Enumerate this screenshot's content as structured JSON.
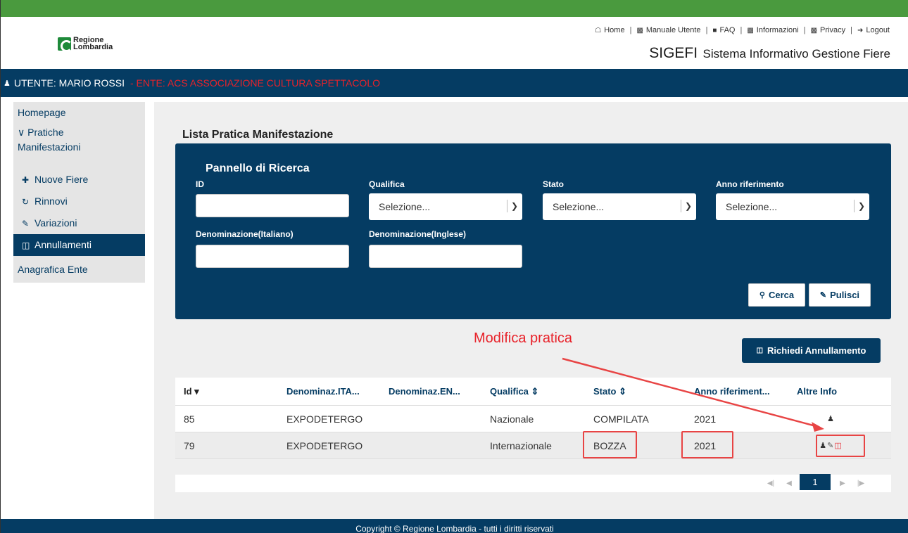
{
  "header": {
    "logo_line1": "Regione",
    "logo_line2": "Lombardia",
    "links": [
      {
        "label": "Home",
        "icon": "home-icon"
      },
      {
        "label": "Manuale Utente",
        "icon": "document-icon"
      },
      {
        "label": "FAQ",
        "icon": "faq-icon"
      },
      {
        "label": "Informazioni",
        "icon": "document-icon"
      },
      {
        "label": "Privacy",
        "icon": "document-icon"
      },
      {
        "label": "Logout",
        "icon": "logout-icon"
      }
    ],
    "app_name": "SIGEFI",
    "app_subtitle": "Sistema Informativo Gestione Fiere"
  },
  "userbar": {
    "user": "UTENTE: MARIO ROSSI",
    "ente": "- ENTE: ACS ASSOCIAZIONE CULTURA SPETTACOLO"
  },
  "sidebar": {
    "homepage": "Homepage",
    "pratiche_line1": "Pratiche",
    "pratiche_line2": "Manifestazioni",
    "sub_items": [
      {
        "label": "Nuove Fiere",
        "icon": "plus-icon"
      },
      {
        "label": "Rinnovi",
        "icon": "refresh-icon"
      },
      {
        "label": "Variazioni",
        "icon": "pencil-icon"
      },
      {
        "label": "Annullamenti",
        "icon": "trash-icon",
        "active": true
      }
    ],
    "anagrafica": "Anagrafica Ente"
  },
  "main": {
    "title": "Lista Pratica Manifestazione",
    "search_panel": {
      "title": "Pannello di Ricerca",
      "id_label": "ID",
      "id_value": "",
      "qualifica_label": "Qualifica",
      "qualifica_value": "Selezione...",
      "stato_label": "Stato",
      "stato_value": "Selezione...",
      "anno_label": "Anno riferimento",
      "anno_value": "Selezione...",
      "den_it_label": "Denominazione(Italiano)",
      "den_it_value": "",
      "den_en_label": "Denominazione(Inglese)",
      "den_en_value": "",
      "cerca_label": "Cerca",
      "pulisci_label": "Pulisci"
    },
    "annotation": "Modifica pratica",
    "annullamento_button": "Richiedi Annullamento",
    "table": {
      "headers": [
        "Id",
        "Denominaz.ITA...",
        "Denominaz.EN...",
        "Qualifica",
        "Stato",
        "Anno riferiment...",
        "Altre Info"
      ],
      "rows": [
        {
          "id": "85",
          "den_ita": "EXPODETERGO",
          "den_en": "",
          "qualifica": "Nazionale",
          "stato": "COMPILATA",
          "anno": "2021"
        },
        {
          "id": "79",
          "den_ita": "EXPODETERGO",
          "den_en": "",
          "qualifica": "Internazionale",
          "stato": "BOZZA",
          "anno": "2021"
        }
      ]
    },
    "pager": {
      "current": "1"
    }
  },
  "footer": "Copyright © Regione Lombardia - tutti i diritti riservati",
  "colors": {
    "brand": "#053c63",
    "topbar": "#4a9a3e",
    "annotation": "#e8222a"
  }
}
